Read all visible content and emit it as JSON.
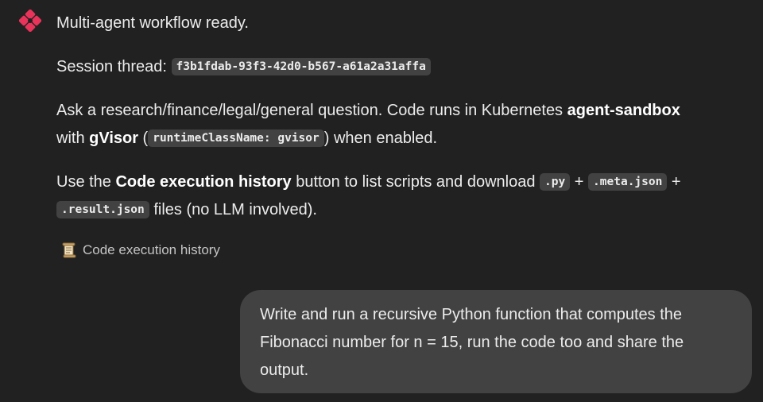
{
  "assistant": {
    "avatar_icon": "agent-logo-icon",
    "accent_color": "#e8345a",
    "ready_text": "Multi-agent workflow ready.",
    "session_label": "Session thread:",
    "session_id": "f3b1fdab-93f3-42d0-b567-a61a2a31affa",
    "ask_intro": "Ask a research/finance/legal/general question. Code runs in Kubernetes ",
    "ask_sandbox": "agent-sandbox",
    "ask_with": "with ",
    "ask_gvisor": "gVisor",
    "ask_paren_open": " (",
    "ask_runtime_code": "runtimeClassName: gvisor",
    "ask_tail": ") when enabled.",
    "use_the": "Use the ",
    "use_history_name": "Code execution history",
    "use_middle": " button to list scripts and download ",
    "use_py": ".py",
    "use_plus1": " + ",
    "use_meta": ".meta.json",
    "use_plus2": " + ",
    "use_result": ".result.json",
    "use_tail": " files (no LLM involved).",
    "history_button_icon": "scroll-icon",
    "history_button_label": "Code execution history"
  },
  "user": {
    "message": "Write and run a recursive Python function that computes the Fibonacci number for n = 15, run the code too and share the output."
  }
}
